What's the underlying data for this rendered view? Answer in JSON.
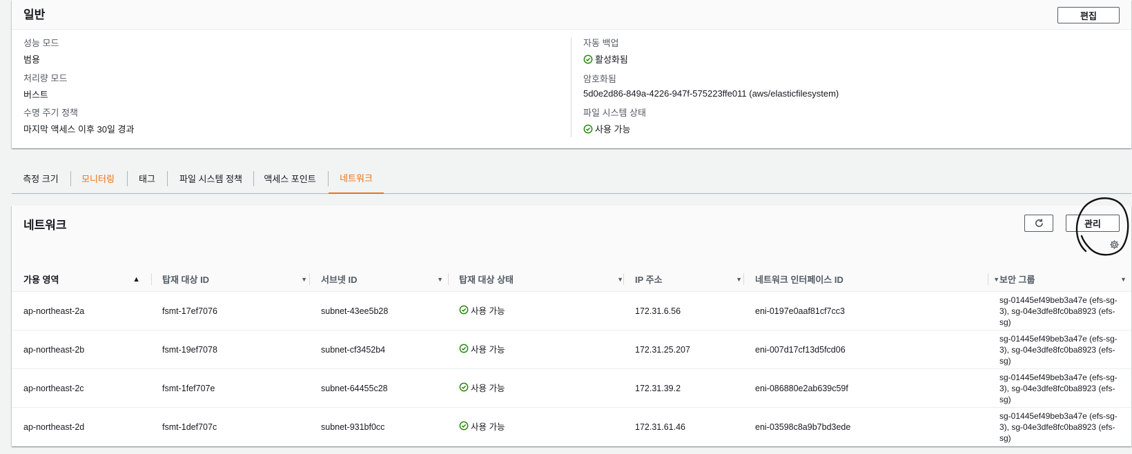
{
  "general": {
    "title": "일반",
    "edit_label": "편집",
    "left": [
      {
        "key": "성능 모드",
        "value": "범용"
      },
      {
        "key": "처리량 모드",
        "value": "버스트"
      },
      {
        "key": "수명 주기 정책",
        "value": "마지막 액세스 이후 30일 경과"
      }
    ],
    "right": [
      {
        "key": "자동 백업",
        "value": "활성화됨",
        "status": true
      },
      {
        "key": "암호화됨",
        "value": "5d0e2d86-849a-4226-947f-575223ffe011 (aws/elasticfilesystem)",
        "status": false
      },
      {
        "key": "파일 시스템 상태",
        "value": "사용 가능",
        "status": true
      }
    ]
  },
  "tabs": [
    {
      "label": "측정 크기",
      "style": "normal"
    },
    {
      "label": "모니터링",
      "style": "orange"
    },
    {
      "label": "태그",
      "style": "normal"
    },
    {
      "label": "파일 시스템 정책",
      "style": "normal"
    },
    {
      "label": "액세스 포인트",
      "style": "normal"
    },
    {
      "label": "네트워크",
      "style": "active"
    }
  ],
  "network": {
    "title": "네트워크",
    "manage_label": "관리",
    "columns": [
      "가용 영역",
      "탑재 대상 ID",
      "서브넷 ID",
      "탑재 대상 상태",
      "IP 주소",
      "네트워크 인터페이스 ID",
      "보안 그룹"
    ],
    "rows": [
      {
        "az": "ap-northeast-2a",
        "mt": "fsmt-17ef7076",
        "subnet": "subnet-43ee5b28",
        "state": "사용 가능",
        "ip": "172.31.6.56",
        "eni": "eni-0197e0aaf81cf7cc3",
        "sg": "sg-01445ef49beb3a47e (efs-sg-3), sg-04e3dfe8fc0ba8923 (efs-sg)"
      },
      {
        "az": "ap-northeast-2b",
        "mt": "fsmt-19ef7078",
        "subnet": "subnet-cf3452b4",
        "state": "사용 가능",
        "ip": "172.31.25.207",
        "eni": "eni-007d17cf13d5fcd06",
        "sg": "sg-01445ef49beb3a47e (efs-sg-3), sg-04e3dfe8fc0ba8923 (efs-sg)"
      },
      {
        "az": "ap-northeast-2c",
        "mt": "fsmt-1fef707e",
        "subnet": "subnet-64455c28",
        "state": "사용 가능",
        "ip": "172.31.39.2",
        "eni": "eni-086880e2ab639c59f",
        "sg": "sg-01445ef49beb3a47e (efs-sg-3), sg-04e3dfe8fc0ba8923 (efs-sg)"
      },
      {
        "az": "ap-northeast-2d",
        "mt": "fsmt-1def707c",
        "subnet": "subnet-931bf0cc",
        "state": "사용 가능",
        "ip": "172.31.61.46",
        "eni": "eni-03598c8a9b7bd3ede",
        "sg": "sg-01445ef49beb3a47e (efs-sg-3), sg-04e3dfe8fc0ba8923 (efs-sg)"
      }
    ]
  },
  "colors": {
    "accent": "#ec7211",
    "success": "#1d8102"
  },
  "icons": [
    "check-circle-icon",
    "refresh-icon",
    "gear-icon",
    "sort-asc-icon",
    "sort-desc-icon"
  ]
}
